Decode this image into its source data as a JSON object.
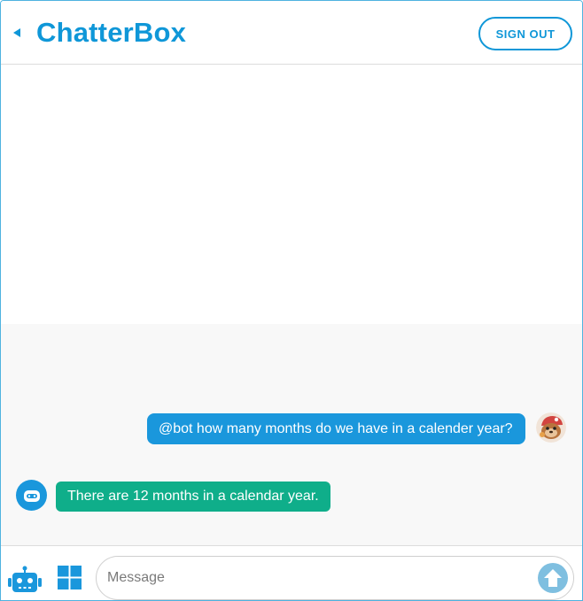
{
  "app": {
    "title": "ChatterBox",
    "sign_out_label": "SIGN OUT"
  },
  "messages": [
    {
      "sender": "user",
      "text": "@bot how many months do we have in a calender year?"
    },
    {
      "sender": "bot",
      "text": "There are 12 months in a calendar year."
    }
  ],
  "composer": {
    "placeholder": "Message"
  },
  "icons": {
    "back": "back-arrow-icon",
    "user_avatar": "user-avatar-icon",
    "bot_avatar": "bot-avatar-icon",
    "bot_button": "robot-icon",
    "apps_button": "grid-apps-icon",
    "send": "send-arrow-icon"
  },
  "colors": {
    "brand": "#0f97d8",
    "user_bubble": "#1a97dc",
    "bot_bubble": "#0fae8a",
    "send": "#7fbfe0"
  }
}
